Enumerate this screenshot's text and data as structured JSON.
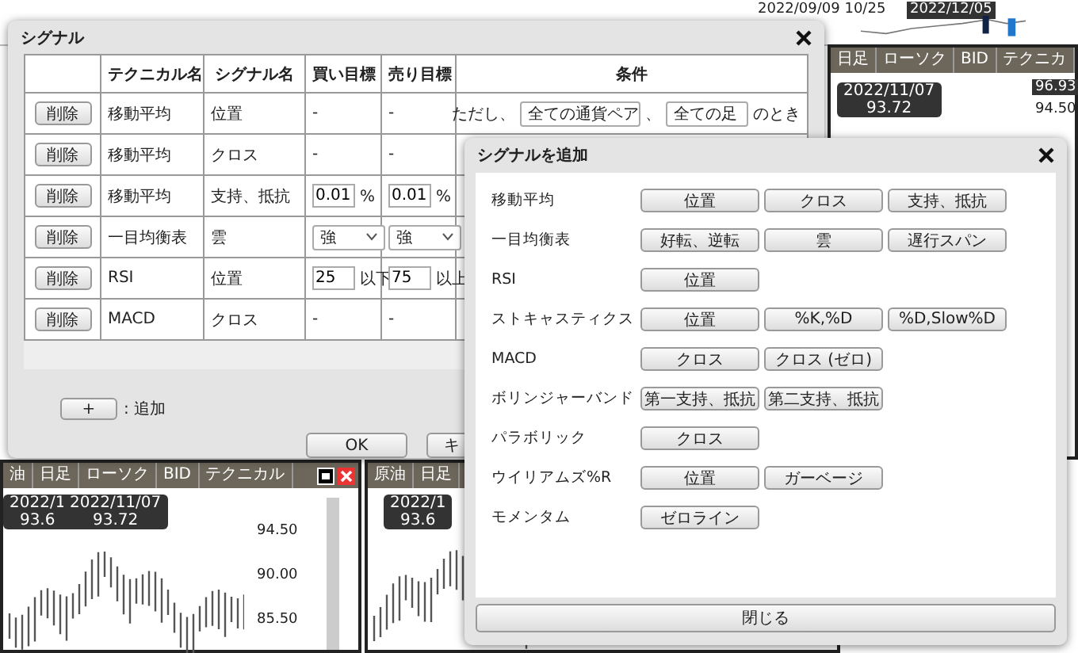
{
  "timeline": {
    "labels": [
      "2022/09/09 10/25",
      "2022/12/05"
    ]
  },
  "charts": [
    {
      "tabs": [
        "日足",
        "ローソク",
        "BID",
        "テクニカ"
      ],
      "tooltips": [
        {
          "date": "2022/11/07",
          "price": "93.72"
        }
      ],
      "price_labels": [
        "96.93",
        "94.50"
      ]
    },
    {
      "tabs": [
        "油",
        "日足",
        "ローソク",
        "BID",
        "テクニカル"
      ],
      "tooltips": [
        {
          "date": "2022/1",
          "price": "93.6"
        },
        {
          "date": "2022/11/07",
          "price": "93.72"
        }
      ],
      "price_labels": [
        "94.50",
        "90.00",
        "85.50"
      ]
    },
    {
      "tabs": [
        "原油",
        "日足"
      ],
      "tooltips": [
        {
          "date": "2022/1",
          "price": "93.6"
        }
      ]
    }
  ],
  "signal_dialog": {
    "title": "シグナル",
    "columns": [
      "テクニカル名",
      "シグナル名",
      "買い目標",
      "売り目標",
      "条件"
    ],
    "rows": [
      {
        "action": "削除",
        "technical": "移動平均",
        "signal": "位置",
        "buy": {
          "kind": "text",
          "value": "-"
        },
        "sell": {
          "kind": "text",
          "value": "-"
        },
        "condition": {
          "prefix": "ただし、",
          "pair": "全ての通貨ペア",
          "separator": "、",
          "timeframe": "全ての足",
          "suffix": "のとき"
        }
      },
      {
        "action": "削除",
        "technical": "移動平均",
        "signal": "クロス",
        "buy": {
          "kind": "text",
          "value": "-"
        },
        "sell": {
          "kind": "text",
          "value": "-"
        }
      },
      {
        "action": "削除",
        "technical": "移動平均",
        "signal": "支持、抵抗",
        "buy": {
          "kind": "input",
          "value": "0.01",
          "unit": "%"
        },
        "sell": {
          "kind": "input",
          "value": "0.01",
          "unit": "%"
        }
      },
      {
        "action": "削除",
        "technical": "一目均衡表",
        "signal": "雲",
        "buy": {
          "kind": "select",
          "value": "強"
        },
        "sell": {
          "kind": "select",
          "value": "強"
        }
      },
      {
        "action": "削除",
        "technical": "RSI",
        "signal": "位置",
        "buy": {
          "kind": "input",
          "value": "25",
          "unit": "以下"
        },
        "sell": {
          "kind": "input",
          "value": "75",
          "unit": "以上"
        }
      },
      {
        "action": "削除",
        "technical": "MACD",
        "signal": "クロス",
        "buy": {
          "kind": "text",
          "value": "-"
        },
        "sell": {
          "kind": "text",
          "value": "-"
        }
      }
    ],
    "add_button": "+",
    "add_label": ": 追加",
    "ok_button": "OK",
    "cancel_button": "キ"
  },
  "add_dialog": {
    "title": "シグナルを追加",
    "groups": [
      {
        "label": "移動平均",
        "buttons": [
          "位置",
          "クロス",
          "支持、抵抗"
        ]
      },
      {
        "label": "一目均衡表",
        "buttons": [
          "好転、逆転",
          "雲",
          "遅行スパン"
        ]
      },
      {
        "label": "RSI",
        "buttons": [
          "位置"
        ]
      },
      {
        "label": "ストキャスティクス",
        "buttons": [
          "位置",
          "%K,%D",
          "%D,Slow%D"
        ]
      },
      {
        "label": "MACD",
        "buttons": [
          "クロス",
          "クロス (ゼロ)"
        ]
      },
      {
        "label": "ボリンジャーバンド",
        "buttons": [
          "第一支持、抵抗",
          "第二支持、抵抗"
        ]
      },
      {
        "label": "パラボリック",
        "buttons": [
          "クロス"
        ]
      },
      {
        "label": "ウイリアムズ%R",
        "buttons": [
          "位置",
          "ガーベージ"
        ]
      },
      {
        "label": "モメンタム",
        "buttons": [
          "ゼロライン"
        ]
      }
    ],
    "close_button": "閉じる"
  }
}
